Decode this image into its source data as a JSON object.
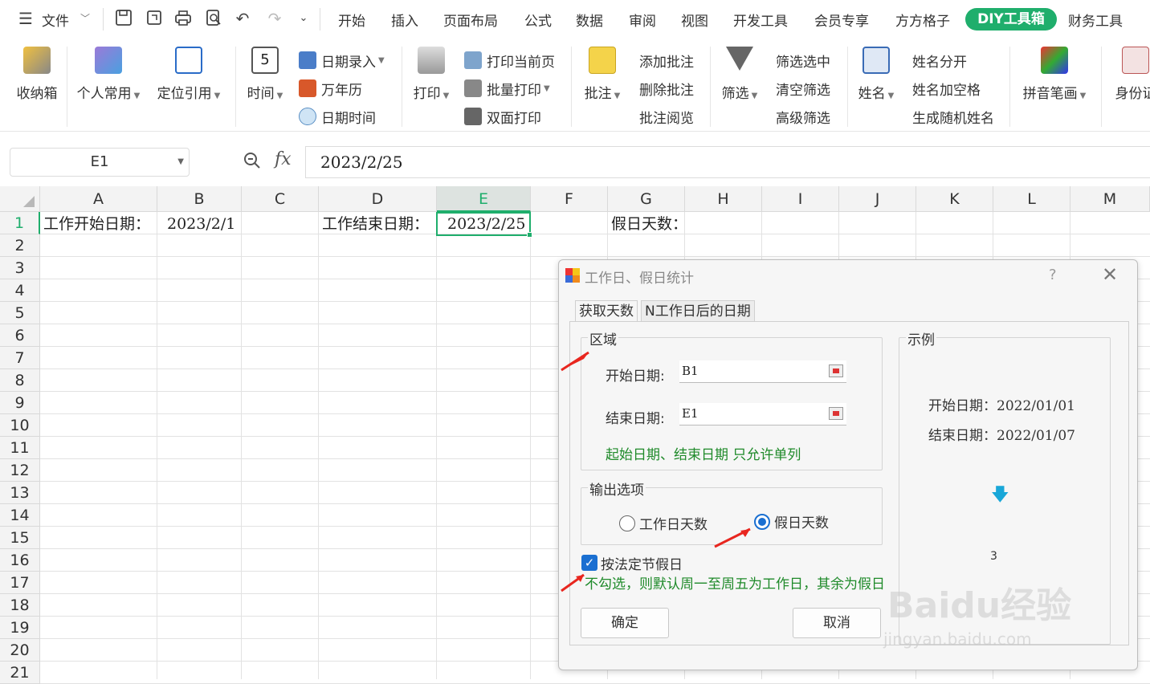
{
  "menubar": {
    "file_label": "文件",
    "tabs": [
      "开始",
      "插入",
      "页面布局",
      "公式",
      "数据",
      "审阅",
      "视图",
      "开发工具",
      "会员专享",
      "方方格子"
    ],
    "active_tab": "DIY工具箱",
    "last_tab": "财务工具"
  },
  "ribbon": {
    "toolbox": "收纳箱",
    "personal": "个人常用",
    "locate_ref": "定位引用",
    "time": "时间",
    "date_entry": "日期录入",
    "calendar": "万年历",
    "datetime": "日期时间",
    "print": "打印",
    "print_current": "打印当前页",
    "batch_print": "批量打印",
    "duplex_print": "双面打印",
    "comment": "批注",
    "add_comment": "添加批注",
    "delete_comment": "删除批注",
    "read_comment": "批注阅览",
    "filter": "筛选",
    "filter_selected": "筛选选中",
    "clear_filter": "清空筛选",
    "advanced_filter": "高级筛选",
    "name": "姓名",
    "split_name": "姓名分开",
    "name_add_space": "姓名加空格",
    "random_name": "生成随机姓名",
    "pinyin": "拼音笔画",
    "id_card": "身份证"
  },
  "formula_bar": {
    "name_box": "E1",
    "fx": "fx",
    "value": "2023/2/25"
  },
  "grid": {
    "columns": [
      "A",
      "B",
      "C",
      "D",
      "E",
      "F",
      "G",
      "H",
      "I",
      "J",
      "K",
      "L",
      "M"
    ],
    "rows": [
      "1",
      "2",
      "3",
      "4",
      "5",
      "6",
      "7",
      "8",
      "9",
      "10",
      "11",
      "12",
      "13",
      "14",
      "15",
      "16",
      "17",
      "18",
      "19",
      "20",
      "21"
    ],
    "cells": {
      "A1": "工作开始日期：",
      "B1": "2023/2/1",
      "D1": "工作结束日期：",
      "E1": "2023/2/25",
      "G1": "假日天数："
    }
  },
  "dialog": {
    "title": "工作日、假日统计",
    "help": "?",
    "close": "✕",
    "tab_active": "获取天数",
    "tab_other": "N工作日后的日期",
    "region_title": "区域",
    "start_label": "开始日期:",
    "start_value": "B1",
    "end_label": "结束日期:",
    "end_value": "E1",
    "region_hint": "起始日期、结束日期 只允许单列",
    "output_title": "输出选项",
    "opt_workdays": "工作日天数",
    "opt_holidays": "假日天数",
    "legal_holiday": "按法定节假日",
    "legal_hint": "不勾选，则默认周一至周五为工作日，其余为假日",
    "ok": "确定",
    "cancel": "取消",
    "example_title": "示例",
    "ex_start": "开始日期：2022/01/01",
    "ex_end": "结束日期：2022/01/07",
    "ex_result": "3"
  },
  "watermark": {
    "main": "Baidu经验",
    "sub": "jingyan.baidu.com"
  },
  "colors": {
    "accent": "#1fae6c",
    "radio": "#1a6fd1",
    "hint_green": "#1f8a2a",
    "arrow_red": "#e8261f"
  }
}
